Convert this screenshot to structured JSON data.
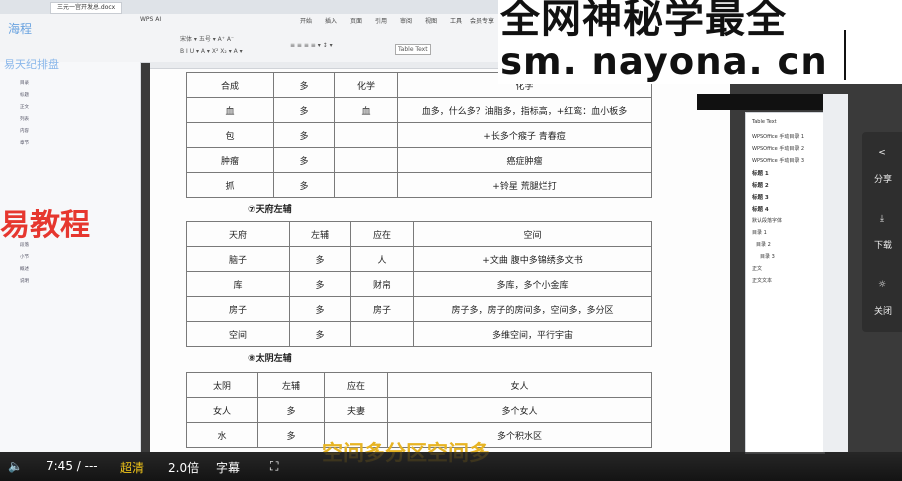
{
  "window": {
    "tab": "三元一宫开发总.docx"
  },
  "ribbon": {
    "tabs": [
      "开始",
      "插入",
      "页面",
      "引用",
      "审阅",
      "视图",
      "工具",
      "会员专享",
      "WPS AI"
    ],
    "style_box": "Table Text"
  },
  "left_panel": {
    "logo": "海程",
    "title": "易天纪排盘",
    "items": [
      "目录",
      "标题",
      "正文",
      "列表",
      "内容",
      "章节",
      "段落",
      "小节",
      "概述",
      "说明"
    ]
  },
  "table1": {
    "rows": [
      [
        "合成",
        "多",
        "化学",
        "化学"
      ],
      [
        "血",
        "多",
        "血",
        "血多，什么多？油脂多，指标高，+红鸾：血小板多"
      ],
      [
        "包",
        "多",
        "",
        "+长多个瘊子  青春痘"
      ],
      [
        "肿瘤",
        "多",
        "",
        "癌症肿瘤"
      ],
      [
        "抓",
        "多",
        "",
        "+铃星  荒腿烂打"
      ]
    ]
  },
  "section7": "⑦天府左辅",
  "table2": {
    "rows": [
      [
        "天府",
        "左辅",
        "应在",
        "空间"
      ],
      [
        "脑子",
        "多",
        "人",
        "+文曲  腹中多锦绣多文书"
      ],
      [
        "库",
        "多",
        "财帛",
        "多库，多个小金库"
      ],
      [
        "房子",
        "多",
        "房子",
        "房子多，房子的房间多，空间多，多分区"
      ],
      [
        "空间",
        "多",
        "",
        "多维空间，平行宇宙"
      ]
    ]
  },
  "section8": "⑧太阴左辅",
  "table3": {
    "rows": [
      [
        "太阴",
        "左辅",
        "应在",
        "女人"
      ],
      [
        "女人",
        "多",
        "夫妻",
        "多个女人"
      ],
      [
        "水",
        "多",
        "",
        "多个积水区"
      ]
    ]
  },
  "styles_panel": {
    "items": [
      "Table Text",
      "WPSOffice 手动目录 1",
      "WPSOffice 手动目录 2",
      "WPSOffice 手动目录 3",
      "标题 1",
      "标题 2",
      "标题 3",
      "标题 4",
      "默认段落字体",
      "目录 1",
      "目录 2",
      "目录 3",
      "正文",
      "正文文本"
    ]
  },
  "side_buttons": {
    "share": "分享",
    "download": "下载",
    "close": "关闭"
  },
  "watermark": {
    "line1": "全网神秘学最全",
    "line2": "sm. nayona. cn"
  },
  "overlay_red": "易教程",
  "subtitle": "空间多分区空间多",
  "player": {
    "time": "7:45 / ---",
    "quality": "超清",
    "speed": "2.0倍",
    "subtitles": "字幕"
  },
  "colors": {
    "accent_red": "#e6372f",
    "subtitle_yellow": "#e7b423",
    "quality_yellow": "#f0c419"
  }
}
